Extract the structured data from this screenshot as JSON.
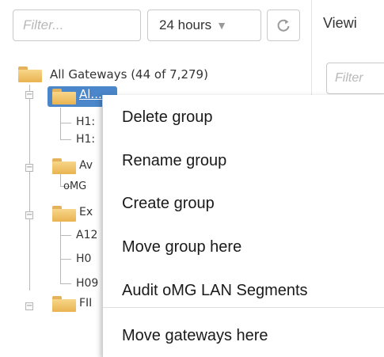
{
  "toolbar": {
    "filter_placeholder": "Filter...",
    "range_label": "24 hours",
    "range_caret": "▼",
    "right_title": "Viewi",
    "right_filter_placeholder": "Filter"
  },
  "tree": {
    "root_label": "All Gateways (44 of 7,279)",
    "selected_group": "Al...",
    "groups": [
      {
        "label": "Av",
        "children": [
          "oMG"
        ]
      },
      {
        "label": "Ex",
        "children": [
          "A12",
          "H0",
          "H09"
        ]
      },
      {
        "label": "FII",
        "children": []
      }
    ],
    "selected_children": [
      "H1:",
      "H1:"
    ]
  },
  "context_menu": {
    "items": [
      "Delete group",
      "Rename group",
      "Create group",
      "Move group here",
      "Audit oMG LAN Segments",
      "Move gateways here"
    ]
  },
  "colors": {
    "selection": "#4a86c9",
    "folder": "#f0c56e"
  },
  "icons": {
    "refresh": "refresh-icon",
    "folder": "folder-icon"
  }
}
